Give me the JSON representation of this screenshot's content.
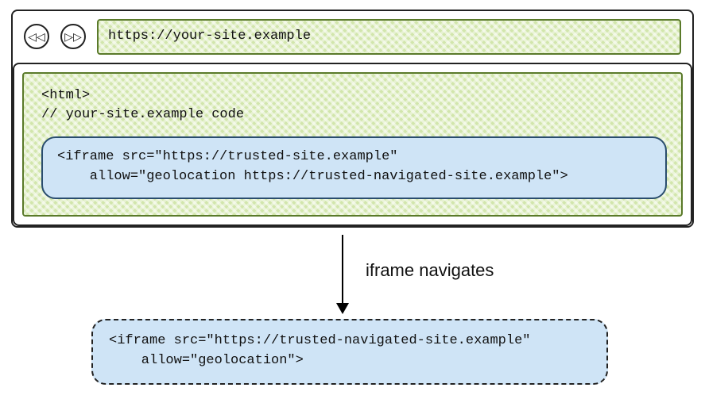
{
  "browser": {
    "back_glyph": "◁◁",
    "fwd_glyph": "▷▷",
    "address": "https://your-site.example"
  },
  "page": {
    "code_line1": "<html>",
    "code_line2": "// your-site.example code",
    "iframe_line1": "<iframe src=\"https://trusted-site.example\"",
    "iframe_line2": "    allow=\"geolocation https://trusted-navigated-site.example\">"
  },
  "arrow": {
    "label": "iframe navigates"
  },
  "navigated": {
    "line1": "<iframe src=\"https://trusted-navigated-site.example\"",
    "line2": "    allow=\"geolocation\">"
  }
}
